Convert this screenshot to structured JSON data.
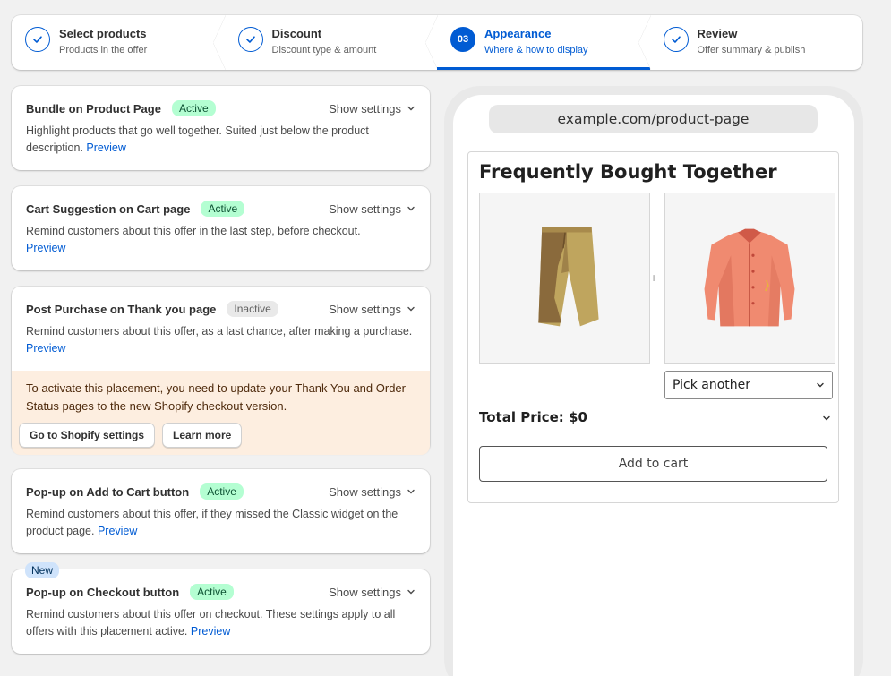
{
  "stepper": [
    {
      "title": "Select products",
      "subtitle": "Products in the offer",
      "status": "done",
      "icon": "check-icon"
    },
    {
      "title": "Discount",
      "subtitle": "Discount type & amount",
      "status": "done",
      "icon": "check-icon"
    },
    {
      "title": "Appearance",
      "subtitle": "Where & how to display",
      "status": "current",
      "number": "03"
    },
    {
      "title": "Review",
      "subtitle": "Offer summary & publish",
      "status": "done",
      "icon": "check-icon"
    }
  ],
  "placements": [
    {
      "title": "Bundle on Product Page",
      "badge": "Active",
      "settings_label": "Show settings",
      "description": "Highlight products that go well together. Suited just below the product description.",
      "preview_label": "Preview"
    },
    {
      "title": "Cart Suggestion on Cart page",
      "badge": "Active",
      "settings_label": "Show settings",
      "description": "Remind customers about this offer in the last step, before checkout.",
      "preview_label": "Preview"
    },
    {
      "title": "Post Purchase on Thank you page",
      "badge": "Inactive",
      "settings_label": "Show settings",
      "description": "Remind customers about this offer, as a last chance, after making a purchase.",
      "preview_label": "Preview",
      "banner": {
        "text": "To activate this placement, you need to update your Thank You and Order Status pages to the new Shopify checkout version.",
        "primary_button": "Go to Shopify settings",
        "secondary_button": "Learn more"
      }
    },
    {
      "title": "Pop-up on Add to Cart button",
      "badge": "Active",
      "settings_label": "Show settings",
      "description": "Remind customers about this offer, if they missed the Classic widget on the product page.",
      "preview_label": "Preview"
    },
    {
      "title": "Pop-up on Checkout button",
      "badge": "Active",
      "settings_label": "Show settings",
      "new_tag": "New",
      "description": "Remind customers about this offer on checkout. These settings apply to all offers with this placement active.",
      "preview_label": "Preview"
    }
  ],
  "preview": {
    "url": "example.com/product-page",
    "widget_title": "Frequently Bought Together",
    "plus": "+",
    "pick_another": "Pick another",
    "total_price": "Total Price: $0",
    "add_to_cart": "Add to cart",
    "products": [
      "shorts-image",
      "shirt-image"
    ]
  },
  "colors": {
    "accent": "#005bd3",
    "active_badge": "#b4fed2",
    "warning_banner": "#fdeee0"
  }
}
